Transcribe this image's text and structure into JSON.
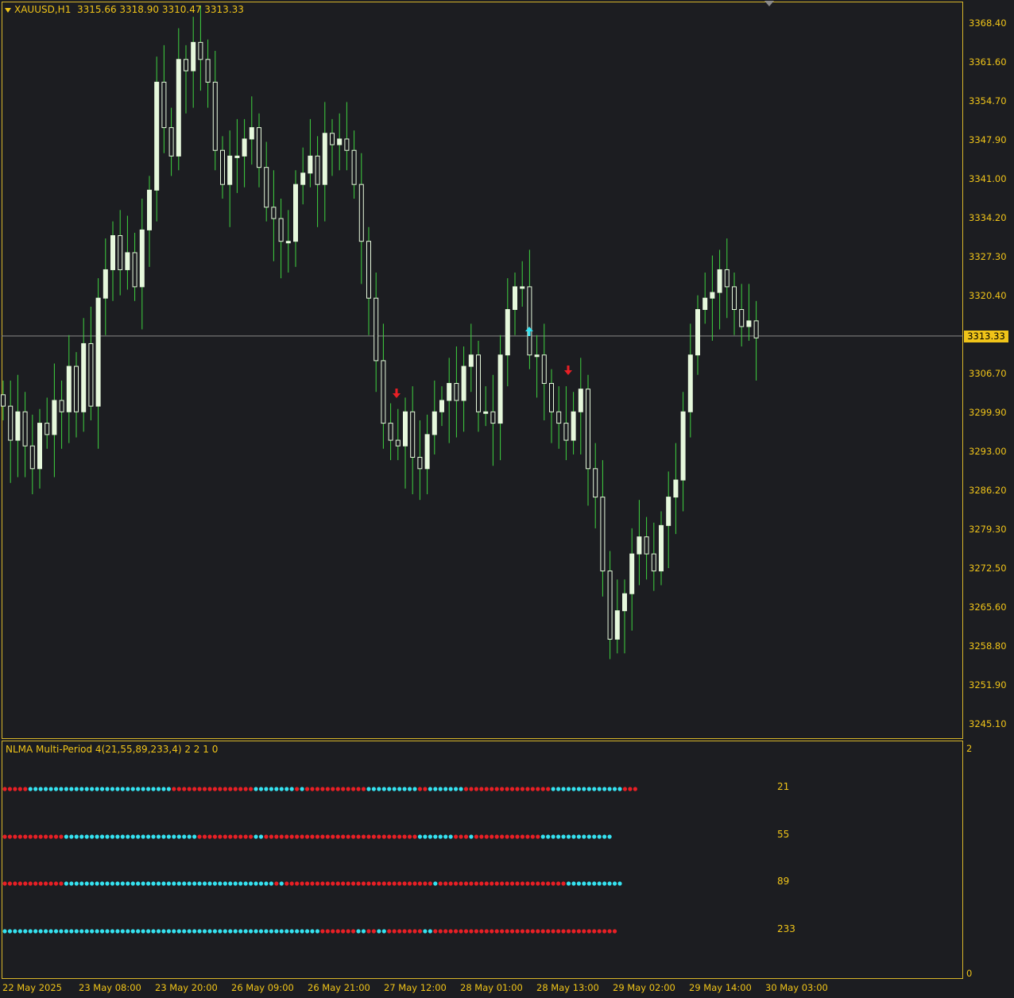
{
  "header": {
    "symbol": "XAUUSD,H1",
    "ohlc": "3315.66 3318.90 3310.47 3313.33"
  },
  "price_axis": [
    "3368.40",
    "3361.60",
    "3354.70",
    "3347.90",
    "3341.00",
    "3334.20",
    "3327.30",
    "3320.40",
    "3313.33",
    "3306.70",
    "3299.90",
    "3293.00",
    "3286.20",
    "3279.30",
    "3272.50",
    "3265.60",
    "3258.80",
    "3251.90",
    "3245.10"
  ],
  "current_price": "3313.33",
  "time_axis": [
    "22 May 2025",
    "23 May 08:00",
    "23 May 20:00",
    "26 May 09:00",
    "26 May 21:00",
    "27 May 12:00",
    "28 May 01:00",
    "28 May 13:00",
    "29 May 02:00",
    "29 May 14:00",
    "30 May 03:00"
  ],
  "indicator": {
    "title": "NLMA Multi-Period 4(21,55,89,233,4) 2 2 1 0",
    "scale_top": "2",
    "scale_bottom": "0",
    "periods": [
      "21",
      "55",
      "89",
      "233"
    ]
  },
  "colors": {
    "bull_dot": "#35e2f0",
    "bear_dot": "#e81f25",
    "candle_up_body": "#e6f8dc",
    "candle_wick": "#3fd23f",
    "border": "#d8b62a",
    "text": "#f0c419"
  },
  "chart_data": {
    "type": "candlestick",
    "symbol": "XAUUSD",
    "timeframe": "H1",
    "ylim": [
      3241,
      3372
    ],
    "grid": false,
    "current_price": 3313.33,
    "closes": [
      3301,
      3295,
      3300,
      3294,
      3290,
      3298,
      3296,
      3302,
      3300,
      3308,
      3300,
      3312,
      3301,
      3320,
      3325,
      3331,
      3325,
      3328,
      3322,
      3332,
      3339,
      3358,
      3350,
      3345,
      3362,
      3360,
      3365,
      3362,
      3358,
      3346,
      3340,
      3345,
      3345,
      3348,
      3350,
      3343,
      3336,
      3334,
      3330,
      3330,
      3340,
      3342,
      3345,
      3340,
      3349,
      3347,
      3348,
      3346,
      3340,
      3330,
      3320,
      3309,
      3298,
      3295,
      3294,
      3300,
      3292,
      3290,
      3296,
      3300,
      3302,
      3305,
      3302,
      3308,
      3310,
      3300,
      3300,
      3298,
      3310,
      3318,
      3322,
      3322,
      3310,
      3310,
      3305,
      3300,
      3298,
      3295,
      3300,
      3304,
      3290,
      3285,
      3272,
      3260,
      3265,
      3268,
      3275,
      3278,
      3275,
      3272,
      3280,
      3285,
      3288,
      3300,
      3310,
      3318,
      3320,
      3321,
      3325,
      3322,
      3318,
      3315,
      3316,
      3313
    ]
  },
  "signals": [
    {
      "type": "down",
      "index": 61
    },
    {
      "type": "up",
      "index": 83
    },
    {
      "type": "down",
      "index": 89
    }
  ],
  "dot_rows": [
    {
      "period": "21",
      "runs": [
        [
          "r",
          5
        ],
        [
          "c",
          28
        ],
        [
          "r",
          16
        ],
        [
          "c",
          8
        ],
        [
          "r",
          1
        ],
        [
          "c",
          1
        ],
        [
          "r",
          12
        ],
        [
          "c",
          10
        ],
        [
          "r",
          2
        ],
        [
          "c",
          7
        ],
        [
          "r",
          17
        ],
        [
          "c",
          14
        ],
        [
          "r",
          3
        ]
      ]
    },
    {
      "period": "55",
      "runs": [
        [
          "r",
          12
        ],
        [
          "c",
          26
        ],
        [
          "r",
          11
        ],
        [
          "c",
          2
        ],
        [
          "r",
          30
        ],
        [
          "c",
          7
        ],
        [
          "r",
          3
        ],
        [
          "c",
          1
        ],
        [
          "r",
          13
        ],
        [
          "c",
          14
        ]
      ]
    },
    {
      "period": "89",
      "runs": [
        [
          "r",
          12
        ],
        [
          "c",
          41
        ],
        [
          "r",
          1
        ],
        [
          "c",
          1
        ],
        [
          "r",
          29
        ],
        [
          "c",
          1
        ],
        [
          "r",
          25
        ],
        [
          "c",
          11
        ]
      ]
    },
    {
      "period": "233",
      "runs": [
        [
          "c",
          62
        ],
        [
          "r",
          4
        ],
        [
          "c",
          0
        ],
        [
          "r",
          3
        ],
        [
          "c",
          2
        ],
        [
          "r",
          2
        ],
        [
          "c",
          2
        ],
        [
          "r",
          7
        ],
        [
          "c",
          2
        ],
        [
          "r",
          36
        ]
      ]
    }
  ]
}
